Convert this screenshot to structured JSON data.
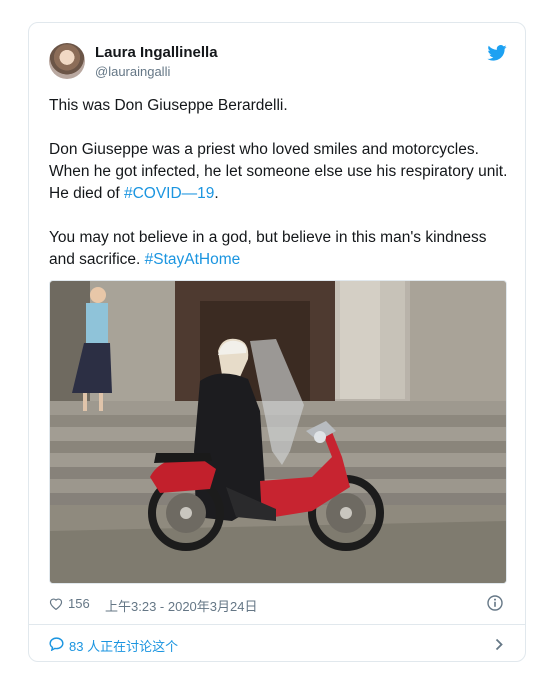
{
  "tweet": {
    "author_name": "Laura Ingallinella",
    "author_handle": "@lauraingalli",
    "line1": "This was Don Giuseppe Berardelli.",
    "para2_text": "Don Giuseppe was a priest who loved smiles and motorcycles. When he got infected, he let someone else use his respiratory unit. He died of ",
    "para2_hashtag": "#COVID—19",
    "para2_end": ".",
    "para3_text": "You may not believe in a god, but believe in this man's kindness and sacrifice. ",
    "para3_hashtag": "#StayAtHome"
  },
  "meta": {
    "likes": "156",
    "timestamp": "上午3:23 - 2020年3月24日"
  },
  "footer": {
    "discussion_count": "83",
    "discussion_label": " 人正在讨论这个"
  },
  "icons": {
    "avatar": "avatar-photo",
    "brand": "twitter-bird-icon",
    "like": "heart-icon",
    "info": "info-icon",
    "reply": "speech-bubble-icon",
    "more": "chevron-right-icon"
  },
  "colors": {
    "link": "#1b95e0",
    "brand": "#1da1f2",
    "secondary_text": "#657786",
    "border": "#e1e8ed"
  }
}
